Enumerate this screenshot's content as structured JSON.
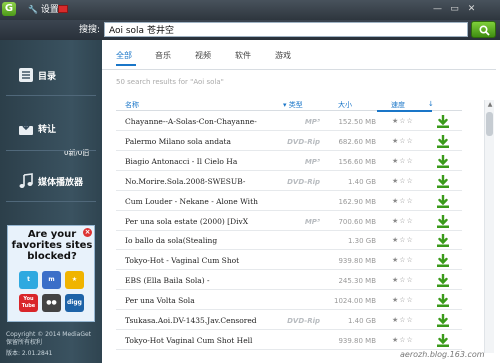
{
  "titlebar": {
    "settings_label": "设置",
    "logo_icon": "app-logo-icon",
    "controls": [
      "minimize",
      "restore",
      "close"
    ]
  },
  "search": {
    "label": "搜搜:",
    "query": "Aoi sola 苍井空",
    "button_icon": "search-icon"
  },
  "sidebar": {
    "items": [
      {
        "label": "目录",
        "icon": "catalog-icon"
      },
      {
        "label": "转让",
        "icon": "transfer-icon"
      },
      {
        "label": "媒体播放器",
        "icon": "media-player-icon"
      }
    ],
    "transfer_counter": "0新/0旧",
    "ad": {
      "text": "Are your favorites sites blocked?",
      "icons": [
        {
          "name": "twitter-icon",
          "label": "t",
          "color": "#2fa9e0"
        },
        {
          "name": "messenger-icon",
          "label": "m",
          "color": "#3b6fc8"
        },
        {
          "name": "runner-icon",
          "label": "★",
          "color": "#f0b400"
        },
        {
          "name": "youtube-icon",
          "label": "You Tube",
          "color": "#d9262a"
        },
        {
          "name": "flickr-icon",
          "label": "●●",
          "color": "#444"
        },
        {
          "name": "digg-icon",
          "label": "digg",
          "color": "#1d63a8"
        }
      ]
    },
    "copyright": "Copyright © 2014 MediaGet",
    "rights": "保留所有权利",
    "version": "版本: 2.01.2841"
  },
  "tabs": [
    {
      "label": "全部",
      "active": true
    },
    {
      "label": "音乐",
      "active": false
    },
    {
      "label": "视频",
      "active": false
    },
    {
      "label": "软件",
      "active": false
    },
    {
      "label": "游戏",
      "active": false
    }
  ],
  "result_count": "50 search results for \"Aoi sola\"",
  "columns": {
    "name": "名称",
    "type": "类型",
    "size": "大小",
    "speed": "速度"
  },
  "rows": [
    {
      "name": "Chayanne--A-Solas-Con-Chayanne-",
      "type": "MP³",
      "size": "152.50 MB",
      "stars": "★☆☆"
    },
    {
      "name": "Palermo Milano sola andata",
      "type": "DVD-Rip",
      "size": "682.60 MB",
      "stars": "★☆☆"
    },
    {
      "name": "Biagio Antonacci - Il Cielo Ha",
      "type": "MP³",
      "size": "156.60 MB",
      "stars": "★☆☆"
    },
    {
      "name": "No.Morire.Sola.2008-SWESUB-",
      "type": "DVD-Rip",
      "size": "1.40 GB",
      "stars": "★☆☆"
    },
    {
      "name": "Cum Louder - Nekane - Alone With",
      "type": "",
      "size": "162.90 MB",
      "stars": "★☆☆"
    },
    {
      "name": "Per una sola estate (2000) [DivX",
      "type": "MP³",
      "size": "700.60 MB",
      "stars": "★☆☆"
    },
    {
      "name": "Io ballo da sola(Stealing",
      "type": "",
      "size": "1.30 GB",
      "stars": "★☆☆"
    },
    {
      "name": "Tokyo-Hot - Vaginal Cum Shot",
      "type": "",
      "size": "939.80 MB",
      "stars": "★☆☆"
    },
    {
      "name": "EBS (Ella Baila Sola) -",
      "type": "",
      "size": "245.30 MB",
      "stars": "★☆☆"
    },
    {
      "name": "Per una Volta Sola",
      "type": "",
      "size": "1024.00 MB",
      "stars": "★☆☆"
    },
    {
      "name": "Tsukasa.Aoi.DV-1435.Jav.Censored",
      "type": "DVD-Rip",
      "size": "1.40 GB",
      "stars": "★☆☆"
    },
    {
      "name": "Tokyo-Hot Vaginal Cum Shot Hell",
      "type": "",
      "size": "939.80 MB",
      "stars": "★☆☆"
    }
  ],
  "watermark": "aerozh.blog.163.com",
  "colors": {
    "accent": "#1a76c8",
    "download_green": "#3a9a1a",
    "sidebar_bg": "#34495a"
  }
}
